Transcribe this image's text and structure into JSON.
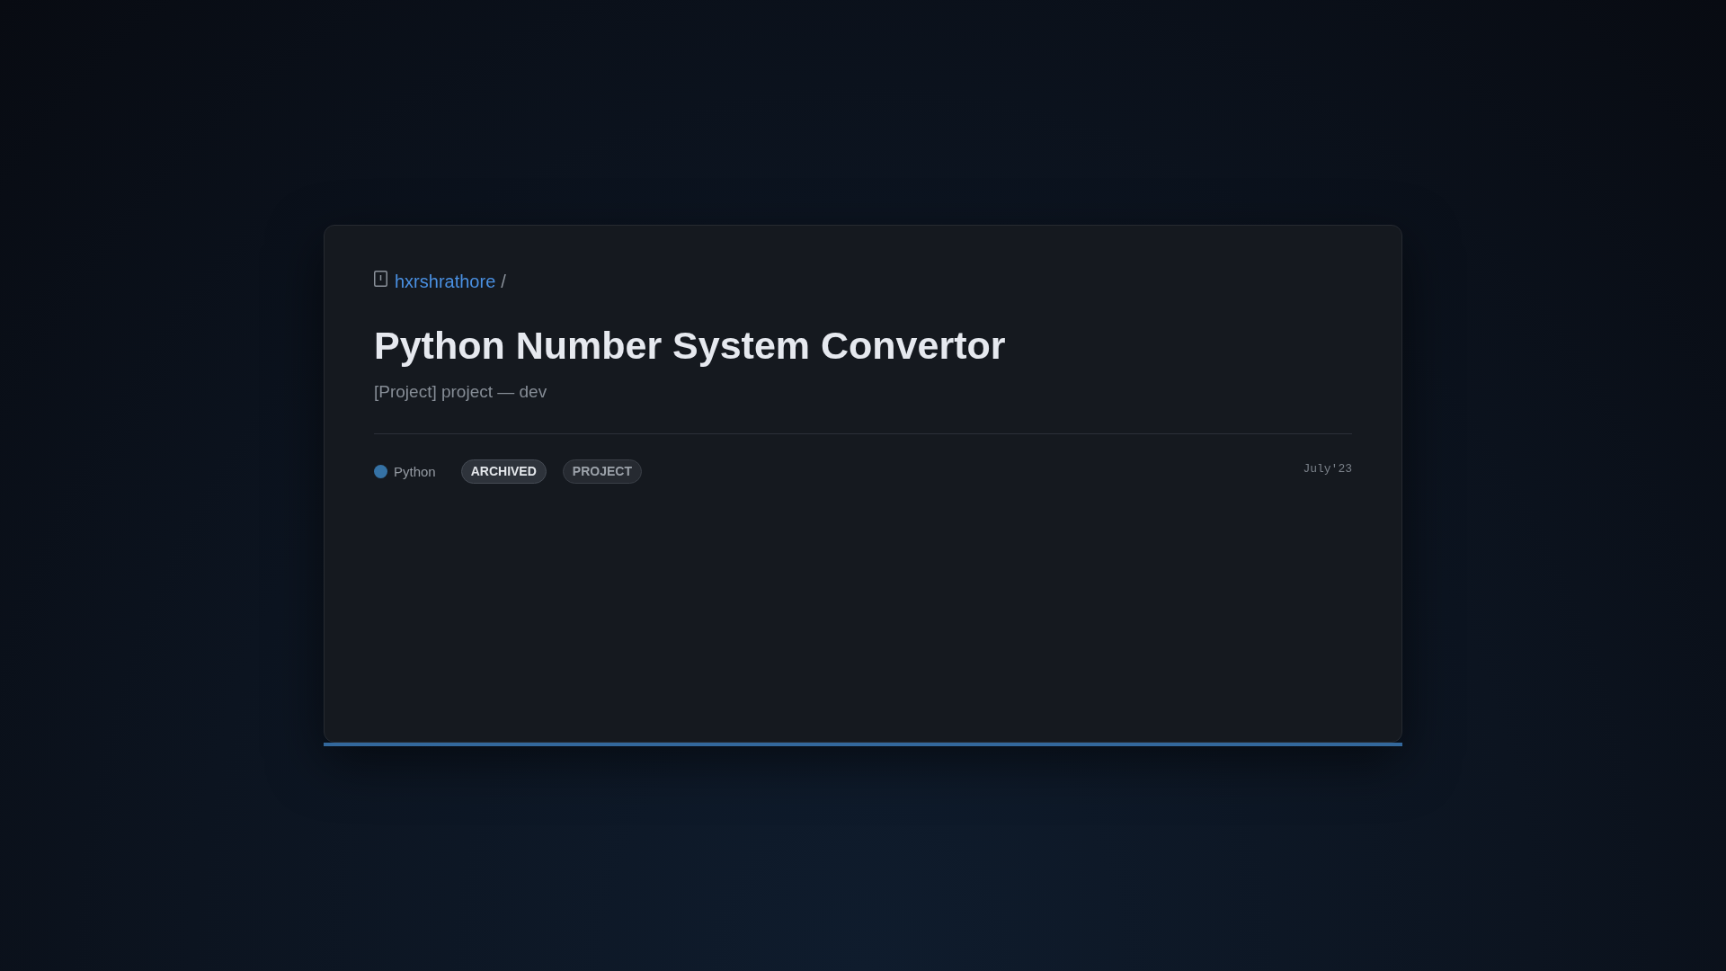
{
  "breadcrumb": {
    "owner": "hxrshrathore",
    "separator": "/"
  },
  "title": "Python Number System Convertor",
  "subtitle": "[Project] project — dev",
  "language": {
    "name": "Python",
    "color": "#3572a5"
  },
  "tags": [
    {
      "label": "ARCHIVED",
      "kind": "status"
    },
    {
      "label": "PROJECT",
      "kind": "type"
    }
  ],
  "date": "July'23"
}
